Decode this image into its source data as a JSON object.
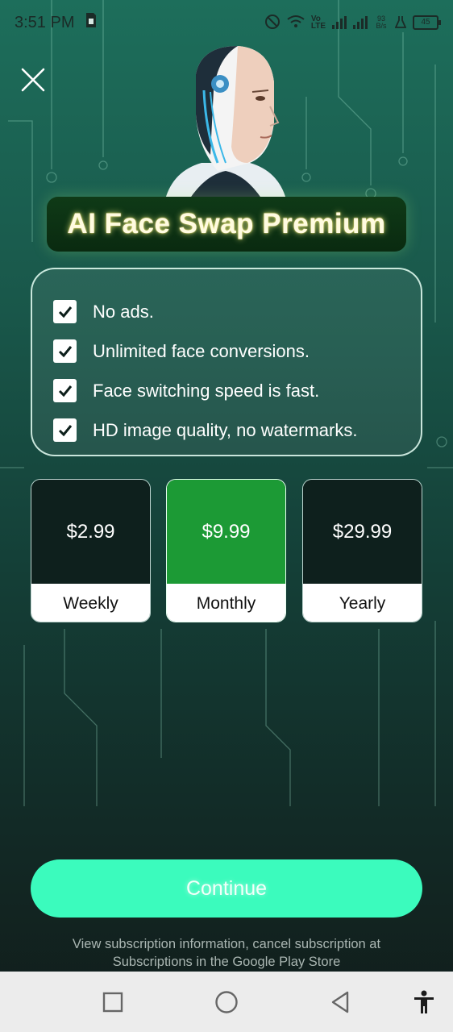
{
  "status_bar": {
    "time": "3:51 PM",
    "network_speed": "93 B/s",
    "battery": "45"
  },
  "title": "AI Face Swap Premium",
  "features": [
    "No ads.",
    "Unlimited face conversions.",
    "Face switching speed is fast.",
    "HD image quality, no watermarks."
  ],
  "plans": [
    {
      "price": "$2.99",
      "period": "Weekly",
      "selected": false
    },
    {
      "price": "$9.99",
      "period": "Monthly",
      "selected": true
    },
    {
      "price": "$29.99",
      "period": "Yearly",
      "selected": false
    }
  ],
  "continue_label": "Continue",
  "footer_note": {
    "line1": "View subscription information, cancel subscription at",
    "line2": "Subscriptions in the Google Play Store"
  },
  "colors": {
    "accent": "#3bfbbd",
    "selected_plan": "#1c9a35",
    "title_glow": "#ffe66a"
  },
  "icons": [
    "close-icon",
    "check-icon",
    "recents-icon",
    "home-icon",
    "back-icon",
    "accessibility-icon"
  ]
}
